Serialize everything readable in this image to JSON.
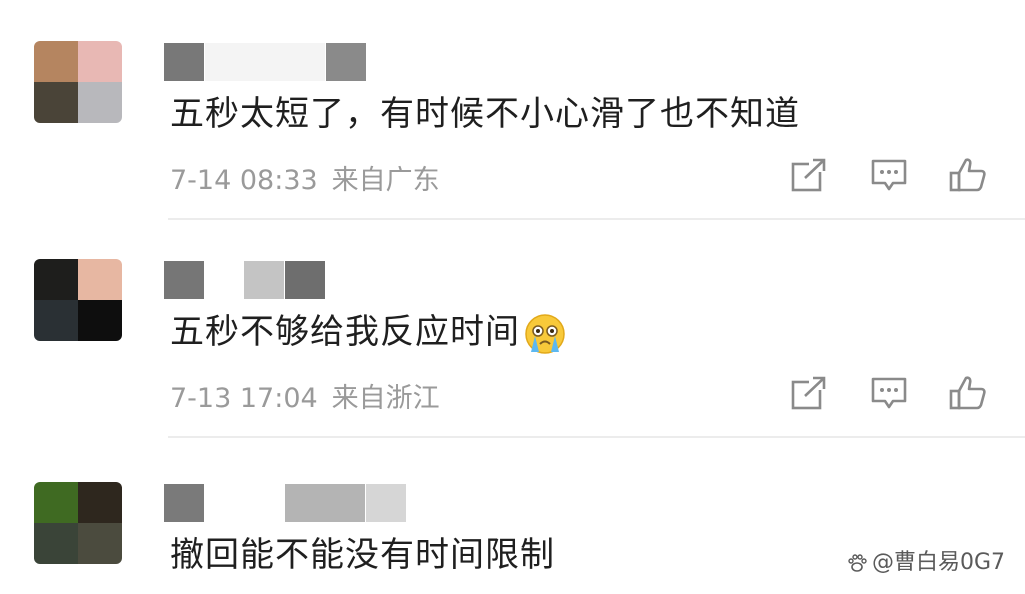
{
  "comments": [
    {
      "text": "五秒太短了，有时候不小心滑了也不知道",
      "date": "7-14 08:33",
      "location": "来自广东",
      "avatar_colors": [
        "#b58560",
        "#e8b8b4",
        "#4a4438",
        "#b8b8bc"
      ]
    },
    {
      "text": "五秒不够给我反应时间",
      "emoji": "crying-face-icon",
      "date": "7-13 17:04",
      "location": "来自浙江",
      "avatar_colors": [
        "#1e1e1c",
        "#e7b7a2",
        "#2a3034",
        "#0e0e0e"
      ]
    },
    {
      "text": "撤回能不能没有时间限制",
      "avatar_colors": [
        "#3f6a22",
        "#2e271e",
        "#3a4438",
        "#4b4b3e"
      ]
    }
  ],
  "watermark": "@曹白易0G7",
  "colors": {
    "text": "#1f1f1f",
    "meta": "#9a9a9a",
    "icon": "#8a8a8a",
    "divider": "#ececec",
    "name_mask": "#7a7a7a"
  },
  "icons": [
    "share-icon",
    "comment-icon",
    "like-icon",
    "crying-face-icon",
    "watermark-paw-icon"
  ]
}
